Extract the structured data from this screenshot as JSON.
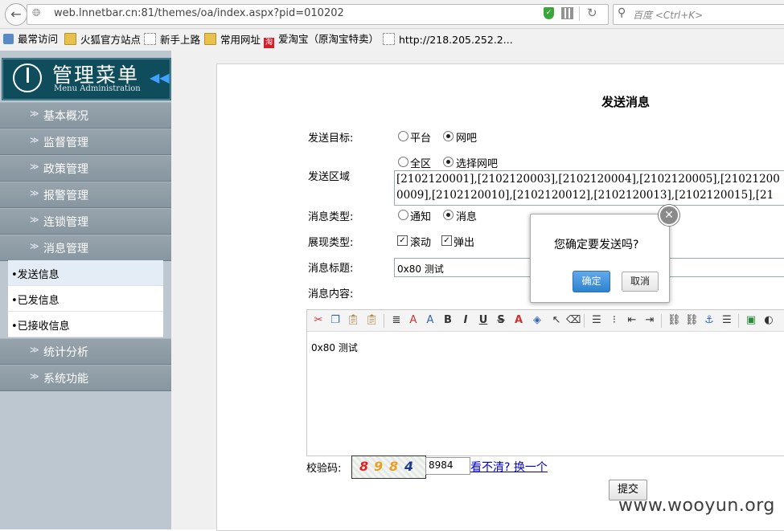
{
  "browser": {
    "url": "web.lnnetbar.cn:81/themes/oa/index.aspx?pid=010202",
    "search_placeholder": "百度 <Ctrl+K>",
    "bookmarks": [
      "最常访问",
      "火狐官方站点",
      "新手上路",
      "常用网址",
      "爱淘宝（原淘宝特卖）",
      "http://218.205.252.2..."
    ]
  },
  "sidebar": {
    "title": "管理菜单",
    "subtitle": "Menu Administration",
    "items_top": [
      "基本概况",
      "监督管理",
      "政策管理",
      "报警管理",
      "连锁管理",
      "消息管理"
    ],
    "subitems": [
      "•发送信息",
      "•已发信息",
      "•已接收信息"
    ],
    "items_bottom": [
      "统计分析",
      "系统功能"
    ]
  },
  "form": {
    "title": "发送消息",
    "target_label": "发送目标:",
    "target_options": [
      "平台",
      "网吧"
    ],
    "target_selected": "网吧",
    "region_label": "发送区域",
    "region_options": [
      "全区",
      "选择网吧"
    ],
    "region_selected": "选择网吧",
    "region_line1": "[2102120001],[2102120003],[2102120004],[2102120005],[21021200",
    "region_line2": "0009],[2102120010],[2102120012],[2102120013],[2102120015],[21",
    "msgtype_label": "消息类型:",
    "msgtype_options": [
      "通知",
      "消息"
    ],
    "msgtype_selected": "消息",
    "display_label": "展现类型:",
    "display_options": [
      "滚动",
      "弹出"
    ],
    "display_checked": [
      "滚动",
      "弹出"
    ],
    "msgtitle_label": "消息标题:",
    "msgtitle_value": "0x80 测试",
    "content_label": "消息内容:",
    "content_value": "0x80 测试",
    "captcha_label": "校验码:",
    "captcha_chars": [
      "8",
      "9",
      "8",
      "4"
    ],
    "captcha_value": "8984",
    "captcha_refresh": "看不清? 换一个",
    "submit": "提交"
  },
  "dialog": {
    "message": "您确定要发送吗?",
    "ok": "确定",
    "cancel": "取消"
  },
  "watermark": "www.wooyun.org"
}
